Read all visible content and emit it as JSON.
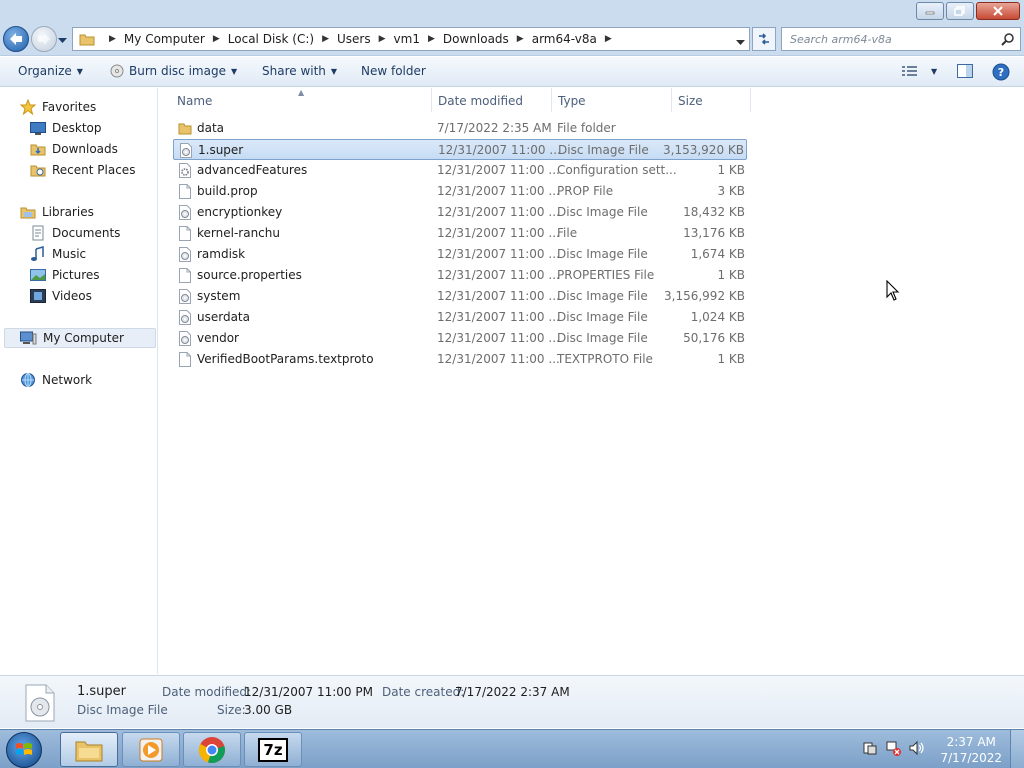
{
  "window": {
    "minimize_icon": "minimize-icon",
    "maximize_icon": "restore-icon",
    "close_icon": "close-icon"
  },
  "address": {
    "crumbs": [
      "My Computer",
      "Local Disk (C:)",
      "Users",
      "vm1",
      "Downloads",
      "arm64-v8a"
    ],
    "search_placeholder": "Search arm64-v8a"
  },
  "toolbar": {
    "organize": "Organize",
    "burn": "Burn disc image",
    "share": "Share with",
    "new_folder": "New folder"
  },
  "nav": {
    "favorites": "Favorites",
    "desktop": "Desktop",
    "downloads": "Downloads",
    "recent": "Recent Places",
    "libraries": "Libraries",
    "documents": "Documents",
    "music": "Music",
    "pictures": "Pictures",
    "videos": "Videos",
    "my_computer": "My Computer",
    "network": "Network"
  },
  "columns": {
    "name": "Name",
    "date": "Date modified",
    "type": "Type",
    "size": "Size"
  },
  "files": [
    {
      "name": "data",
      "date": "7/17/2022 2:35 AM",
      "type": "File folder",
      "size": "",
      "icon": "folder-icon"
    },
    {
      "name": "1.super",
      "date": "12/31/2007 11:00 ...",
      "type": "Disc Image File",
      "size": "3,153,920 KB",
      "icon": "disc-image-icon"
    },
    {
      "name": "advancedFeatures",
      "date": "12/31/2007 11:00 ...",
      "type": "Configuration sett...",
      "size": "1 KB",
      "icon": "config-file-icon"
    },
    {
      "name": "build.prop",
      "date": "12/31/2007 11:00 ...",
      "type": "PROP File",
      "size": "3 KB",
      "icon": "file-icon"
    },
    {
      "name": "encryptionkey",
      "date": "12/31/2007 11:00 ...",
      "type": "Disc Image File",
      "size": "18,432 KB",
      "icon": "disc-image-icon"
    },
    {
      "name": "kernel-ranchu",
      "date": "12/31/2007 11:00 ...",
      "type": "File",
      "size": "13,176 KB",
      "icon": "file-icon"
    },
    {
      "name": "ramdisk",
      "date": "12/31/2007 11:00 ...",
      "type": "Disc Image File",
      "size": "1,674 KB",
      "icon": "disc-image-icon"
    },
    {
      "name": "source.properties",
      "date": "12/31/2007 11:00 ...",
      "type": "PROPERTIES File",
      "size": "1 KB",
      "icon": "file-icon"
    },
    {
      "name": "system",
      "date": "12/31/2007 11:00 ...",
      "type": "Disc Image File",
      "size": "3,156,992 KB",
      "icon": "disc-image-icon"
    },
    {
      "name": "userdata",
      "date": "12/31/2007 11:00 ...",
      "type": "Disc Image File",
      "size": "1,024 KB",
      "icon": "disc-image-icon"
    },
    {
      "name": "vendor",
      "date": "12/31/2007 11:00 ...",
      "type": "Disc Image File",
      "size": "50,176 KB",
      "icon": "disc-image-icon"
    },
    {
      "name": "VerifiedBootParams.textproto",
      "date": "12/31/2007 11:00 ...",
      "type": "TEXTPROTO File",
      "size": "1 KB",
      "icon": "file-icon"
    }
  ],
  "details": {
    "name": "1.super",
    "kind": "Disc Image File",
    "modified_label": "Date modified:",
    "modified_value": "12/31/2007 11:00 PM",
    "created_label": "Date created:",
    "created_value": "7/17/2022 2:37 AM",
    "size_label": "Size:",
    "size_value": "3.00 GB"
  },
  "taskbar": {
    "time": "2:37 AM",
    "date": "7/17/2022",
    "seven_zip_label": "7z"
  },
  "colors": {
    "accent": "#1e3c64",
    "selection": "#c6dcf4",
    "taskbar": "#7ca0c8"
  }
}
